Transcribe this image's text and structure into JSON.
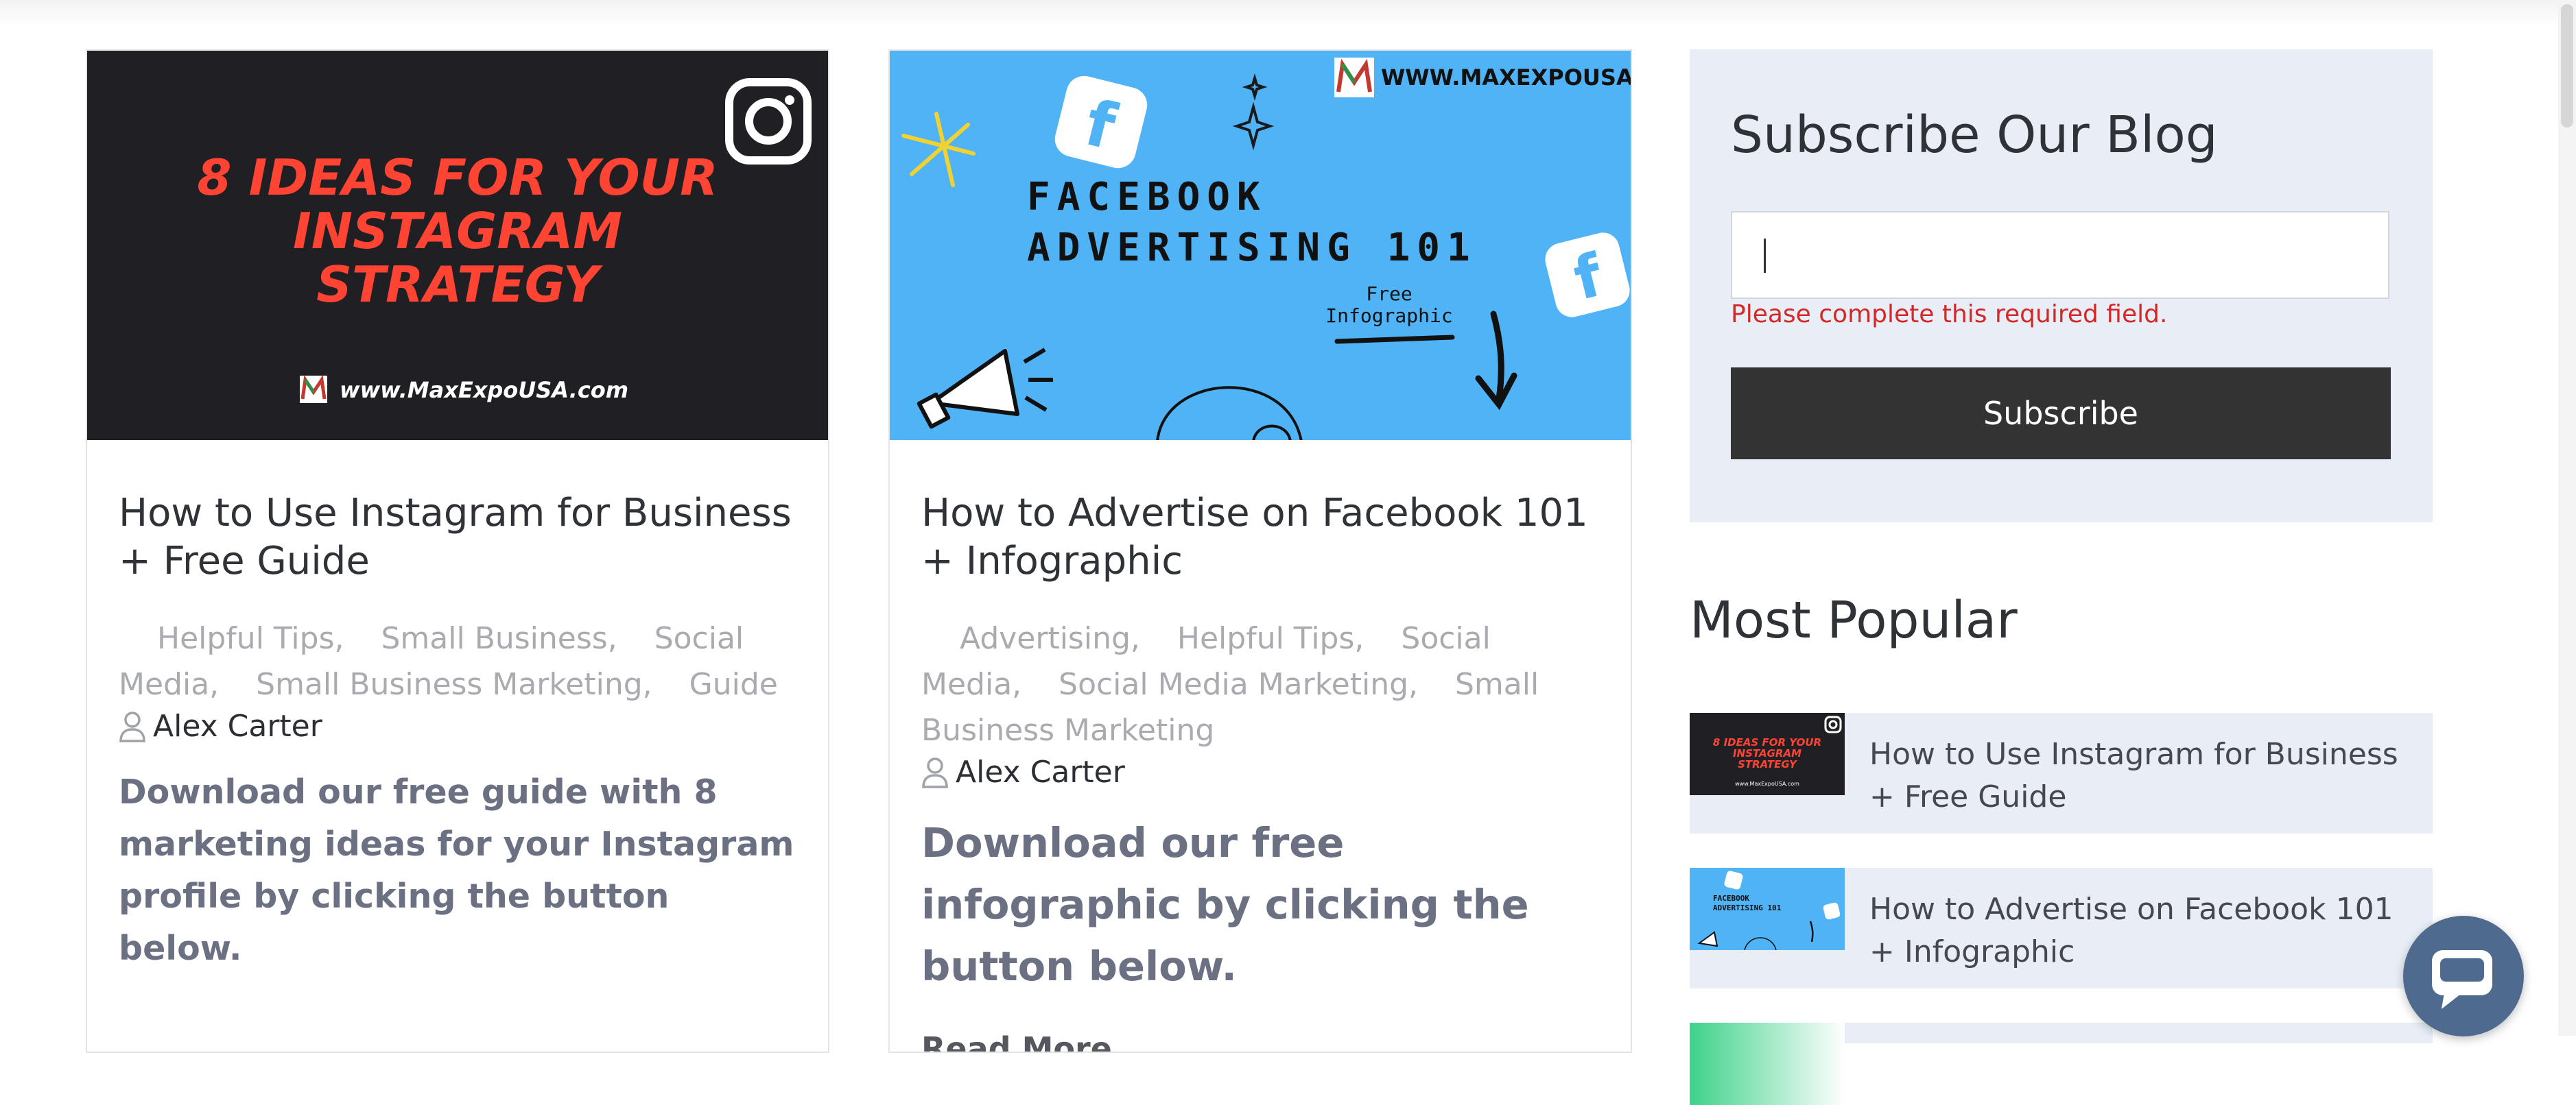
{
  "posts": [
    {
      "image": {
        "headline": [
          "8 IDEAS FOR YOUR",
          "INSTAGRAM",
          "STRATEGY"
        ],
        "site": "www.MaxExpoUSA.com",
        "icon": "instagram-icon",
        "bg_color": "#1f1f24",
        "headline_color": "#ff4433"
      },
      "title": "How to Use Instagram for Business + Free Guide",
      "categories": [
        "Helpful Tips,",
        "Small Business,",
        "Social Media,",
        "Small Business Marketing,",
        "Guide"
      ],
      "author": "Alex Carter",
      "excerpt": "Download our free guide with 8 marketing ideas for your Instagram profile by clicking the button below."
    },
    {
      "image": {
        "site": "WWW.MAXEXPOUSA.COM",
        "headline": [
          "FACEBOOK",
          "ADVERTISING 101"
        ],
        "sub": [
          "Free",
          "Infographic"
        ],
        "icon": "facebook-icon",
        "bg_color": "#4fb3f6"
      },
      "title": "How to Advertise on Facebook 101 + Infographic",
      "categories": [
        "Advertising,",
        "Helpful Tips,",
        "Social Media,",
        "Social Media Marketing,",
        "Small Business Marketing"
      ],
      "author": "Alex Carter",
      "excerpt": "Download our free infographic by clicking the button below.",
      "read_more": "Read More"
    }
  ],
  "subscribe": {
    "title": "Subscribe Our Blog",
    "email_value": "",
    "error": "Please complete this required field.",
    "button": "Subscribe"
  },
  "most_popular": {
    "title": "Most Popular",
    "items": [
      {
        "label": "How to Use Instagram for Business + Free Guide"
      },
      {
        "label": "How to Advertise on Facebook 101 + Infographic"
      }
    ]
  },
  "chat": {
    "icon": "chat-bubble-icon",
    "color": "#4f6a8f"
  },
  "colors": {
    "panel": "#e9eef6",
    "button": "#333333",
    "error": "#d42828",
    "meta": "#a9abb0"
  }
}
